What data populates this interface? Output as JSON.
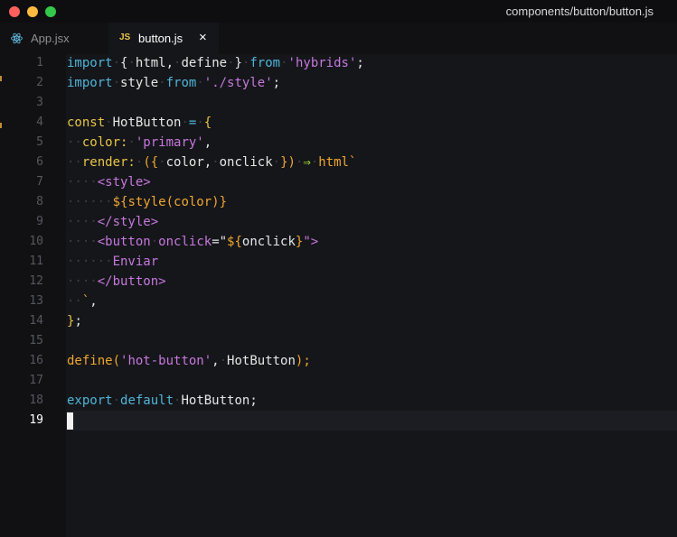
{
  "window": {
    "title": "components/button/button.js"
  },
  "tabs": [
    {
      "label": "App.jsx",
      "icon": "react-icon",
      "active": false
    },
    {
      "label": "button.js",
      "icon": "js-icon",
      "icon_text": "JS",
      "active": true,
      "close": "×"
    }
  ],
  "gutter": {
    "lines": [
      "1",
      "2",
      "3",
      "4",
      "5",
      "6",
      "7",
      "8",
      "9",
      "10",
      "11",
      "12",
      "13",
      "14",
      "15",
      "16",
      "17",
      "18",
      "19"
    ],
    "current_line": "19"
  },
  "code": {
    "line1": [
      {
        "t": "import",
        "c": "kw"
      },
      {
        "t": "·",
        "c": "ws"
      },
      {
        "t": "{",
        "c": "punc"
      },
      {
        "t": "·",
        "c": "ws"
      },
      {
        "t": "html,",
        "c": "var"
      },
      {
        "t": "·",
        "c": "ws"
      },
      {
        "t": "define",
        "c": "var"
      },
      {
        "t": "·",
        "c": "ws"
      },
      {
        "t": "}",
        "c": "punc"
      },
      {
        "t": "·",
        "c": "ws"
      },
      {
        "t": "from",
        "c": "kw"
      },
      {
        "t": "·",
        "c": "ws"
      },
      {
        "t": "'hybrids'",
        "c": "str"
      },
      {
        "t": ";",
        "c": "punc"
      }
    ],
    "line2": [
      {
        "t": "import",
        "c": "kw"
      },
      {
        "t": "·",
        "c": "ws"
      },
      {
        "t": "style",
        "c": "var"
      },
      {
        "t": "·",
        "c": "ws"
      },
      {
        "t": "from",
        "c": "kw"
      },
      {
        "t": "·",
        "c": "ws"
      },
      {
        "t": "'./style'",
        "c": "str"
      },
      {
        "t": ";",
        "c": "punc"
      }
    ],
    "line3": [],
    "line4": [
      {
        "t": "const",
        "c": "prop"
      },
      {
        "t": "·",
        "c": "ws"
      },
      {
        "t": "HotButton",
        "c": "var"
      },
      {
        "t": "·",
        "c": "ws"
      },
      {
        "t": "=",
        "c": "op"
      },
      {
        "t": "·",
        "c": "ws"
      },
      {
        "t": "{",
        "c": "prop"
      }
    ],
    "line5": [
      {
        "t": "··",
        "c": "ws"
      },
      {
        "t": "color:",
        "c": "prop"
      },
      {
        "t": "·",
        "c": "ws"
      },
      {
        "t": "'primary'",
        "c": "str"
      },
      {
        "t": ",",
        "c": "punc"
      }
    ],
    "line6": [
      {
        "t": "··",
        "c": "ws"
      },
      {
        "t": "render:",
        "c": "prop"
      },
      {
        "t": "·",
        "c": "ws"
      },
      {
        "t": "({",
        "c": "fn"
      },
      {
        "t": "·",
        "c": "ws"
      },
      {
        "t": "color,",
        "c": "var"
      },
      {
        "t": "·",
        "c": "ws"
      },
      {
        "t": "onclick",
        "c": "var"
      },
      {
        "t": "·",
        "c": "ws"
      },
      {
        "t": "})",
        "c": "fn"
      },
      {
        "t": "·",
        "c": "ws"
      },
      {
        "t": "⇒",
        "c": "arrow"
      },
      {
        "t": "·",
        "c": "ws"
      },
      {
        "t": "html`",
        "c": "fn"
      }
    ],
    "line7": [
      {
        "t": "····",
        "c": "ws"
      },
      {
        "t": "<style>",
        "c": "tag"
      }
    ],
    "line8": [
      {
        "t": "······",
        "c": "ws"
      },
      {
        "t": "${",
        "c": "tmpl"
      },
      {
        "t": "style(color)",
        "c": "fn"
      },
      {
        "t": "}",
        "c": "tmpl"
      }
    ],
    "line9": [
      {
        "t": "····",
        "c": "ws"
      },
      {
        "t": "</style>",
        "c": "tag"
      }
    ],
    "line10": [
      {
        "t": "····",
        "c": "ws"
      },
      {
        "t": "<button",
        "c": "tag"
      },
      {
        "t": "·",
        "c": "ws"
      },
      {
        "t": "onclick",
        "c": "tag"
      },
      {
        "t": "=\"",
        "c": "punc"
      },
      {
        "t": "${",
        "c": "tmpl"
      },
      {
        "t": "onclick",
        "c": "var"
      },
      {
        "t": "}",
        "c": "tmpl"
      },
      {
        "t": "\">",
        "c": "tag"
      }
    ],
    "line11": [
      {
        "t": "······",
        "c": "ws"
      },
      {
        "t": "Enviar",
        "c": "tag"
      }
    ],
    "line12": [
      {
        "t": "····",
        "c": "ws"
      },
      {
        "t": "</button>",
        "c": "tag"
      }
    ],
    "line13": [
      {
        "t": "··",
        "c": "ws"
      },
      {
        "t": "`",
        "c": "fn"
      },
      {
        "t": ",",
        "c": "punc"
      }
    ],
    "line14": [
      {
        "t": "}",
        "c": "prop"
      },
      {
        "t": ";",
        "c": "punc"
      }
    ],
    "line15": [],
    "line16": [
      {
        "t": "define(",
        "c": "fn"
      },
      {
        "t": "'hot-button'",
        "c": "str"
      },
      {
        "t": ",",
        "c": "punc"
      },
      {
        "t": "·",
        "c": "ws"
      },
      {
        "t": "HotButton",
        "c": "var"
      },
      {
        "t": ");",
        "c": "fn"
      }
    ],
    "line17": [],
    "line18": [
      {
        "t": "export",
        "c": "kw"
      },
      {
        "t": "·",
        "c": "ws"
      },
      {
        "t": "default",
        "c": "kw"
      },
      {
        "t": "·",
        "c": "ws"
      },
      {
        "t": "HotButton",
        "c": "var"
      },
      {
        "t": ";",
        "c": "punc"
      }
    ],
    "line19": []
  },
  "colors": {
    "background": "#15161a",
    "keyword": "#4fb5d8",
    "string": "#c678dd",
    "function": "#f0a630",
    "property": "#e7c547",
    "arrow": "#a6e22e"
  }
}
